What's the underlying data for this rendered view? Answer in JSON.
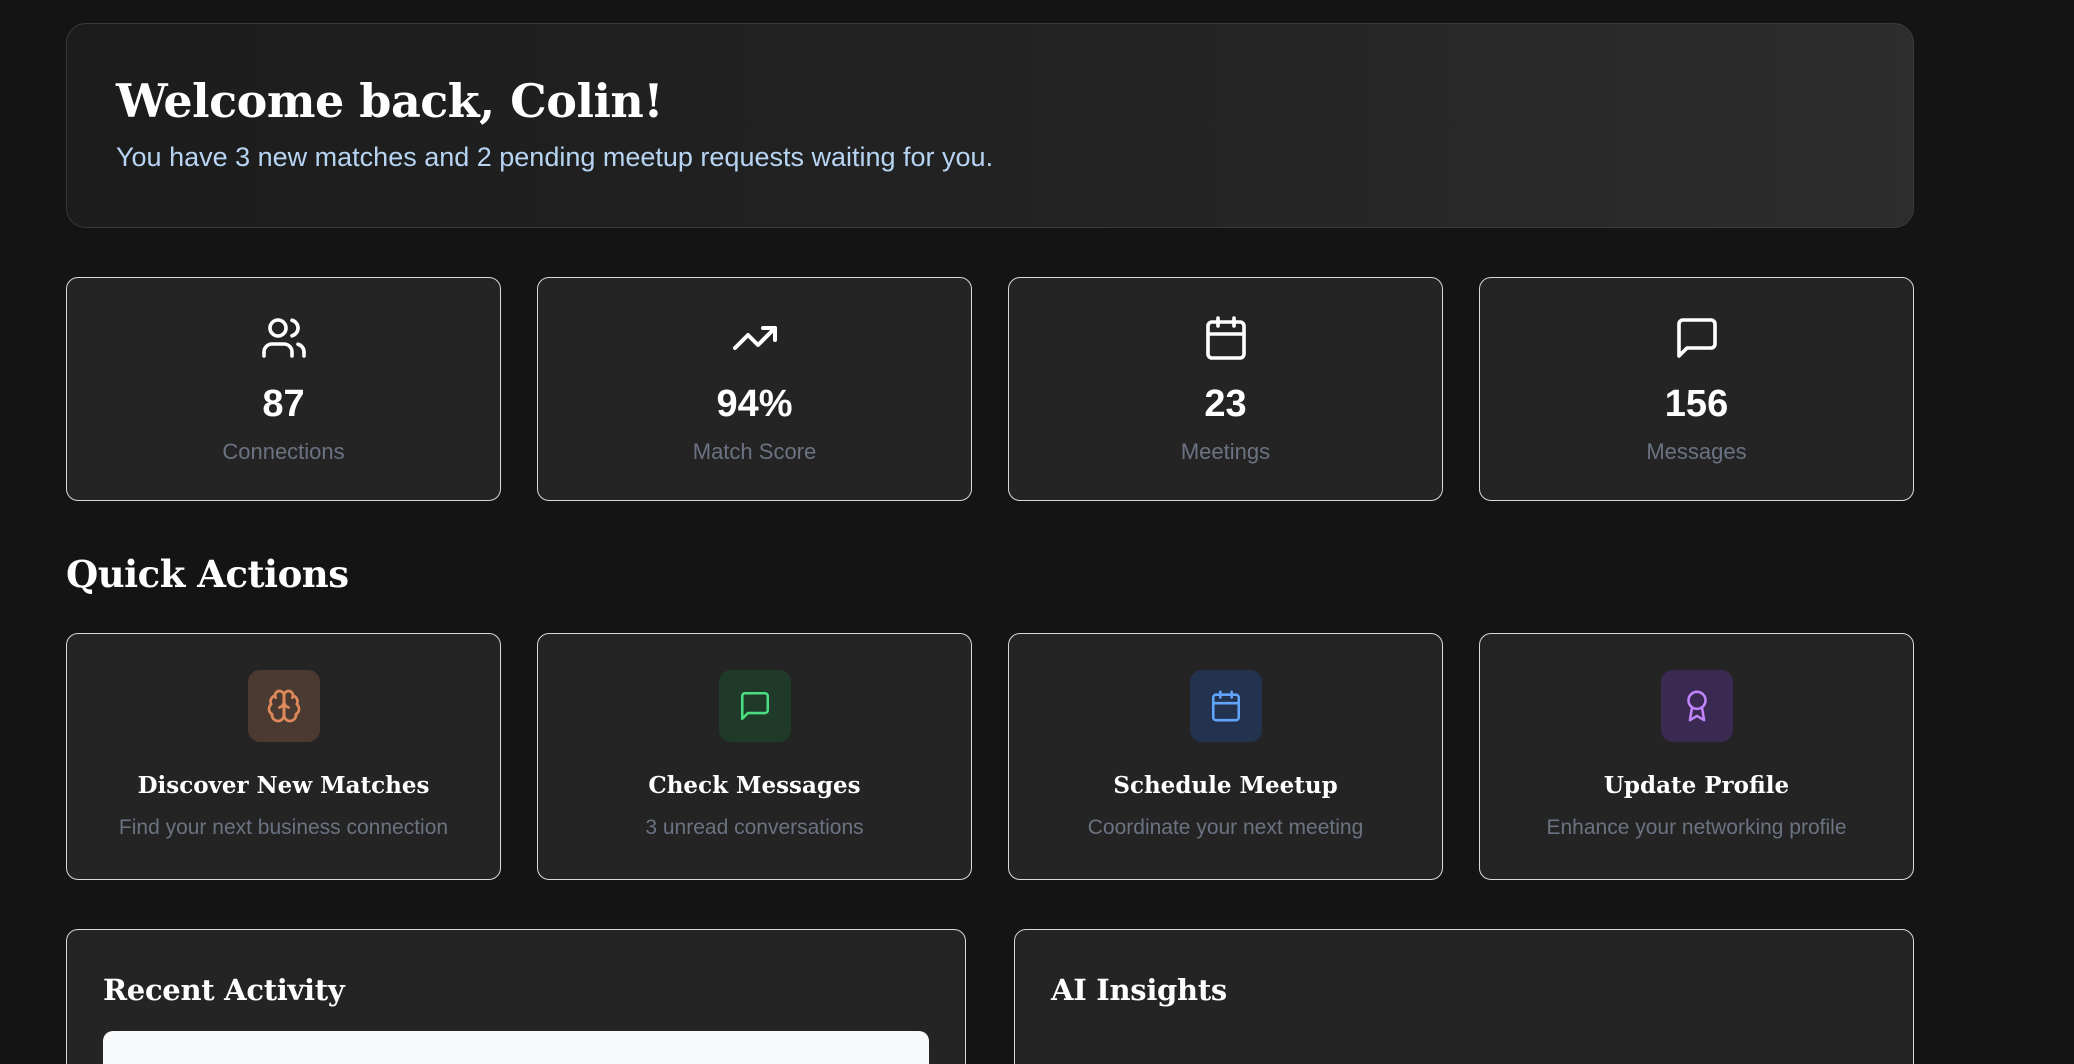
{
  "welcome": {
    "heading": "Welcome back, Colin!",
    "subtitle": "You have 3 new matches and 2 pending meetup requests waiting for you."
  },
  "stats": [
    {
      "icon": "users-icon",
      "value": "87",
      "label": "Connections"
    },
    {
      "icon": "trending-up-icon",
      "value": "94%",
      "label": "Match Score"
    },
    {
      "icon": "calendar-icon",
      "value": "23",
      "label": "Meetings"
    },
    {
      "icon": "message-square-icon",
      "value": "156",
      "label": "Messages"
    }
  ],
  "quick_actions": {
    "title": "Quick Actions",
    "items": [
      {
        "icon": "brain-icon",
        "title": "Discover New Matches",
        "description": "Find your next business connection",
        "accent": "#e08a5c",
        "badge_bg": "#4a3a32"
      },
      {
        "icon": "message-square-icon",
        "title": "Check Messages",
        "description": "3 unread conversations",
        "accent": "#4ade80",
        "badge_bg": "#1f3a28"
      },
      {
        "icon": "calendar-icon",
        "title": "Schedule Meetup",
        "description": "Coordinate your next meeting",
        "accent": "#60a5fa",
        "badge_bg": "#23324f"
      },
      {
        "icon": "award-icon",
        "title": "Update Profile",
        "description": "Enhance your networking profile",
        "accent": "#c084fc",
        "badge_bg": "#3a2950"
      }
    ]
  },
  "recent_activity": {
    "title": "Recent Activity"
  },
  "ai_insights": {
    "title": "AI Insights"
  }
}
